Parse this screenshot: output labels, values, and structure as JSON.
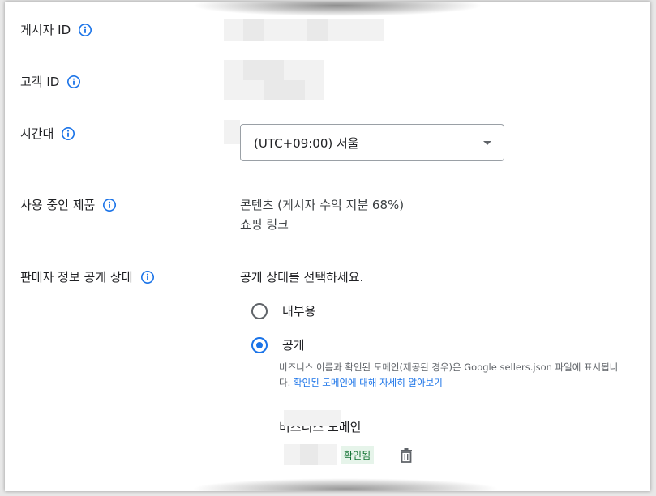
{
  "fields": {
    "publisher_id": {
      "label": "게시자 ID"
    },
    "customer_id": {
      "label": "고객 ID"
    },
    "timezone": {
      "label": "시간대",
      "value": "(UTC+09:00) 서울"
    },
    "products": {
      "label": "사용 중인 제품",
      "items": [
        "콘텐츠 (게시자 수익 지분 68%)",
        "쇼핑 링크"
      ]
    }
  },
  "seller_info": {
    "label": "판매자 정보 공개 상태",
    "prompt": "공개 상태를 선택하세요.",
    "options": [
      {
        "label": "내부용",
        "selected": false
      },
      {
        "label": "공개",
        "selected": true
      }
    ],
    "help_text": "비즈니스 이름과 확인된 도메인(제공된 경우)은 Google sellers.json 파일에 표시됩니다.",
    "help_link": "확인된 도메인에 대해 자세히 알아보기",
    "domain_label": "비즈니스 도메인",
    "verified_badge": "확인됨"
  },
  "colors": {
    "accent": "#1a73e8",
    "badge_bg": "#e6f4ea",
    "badge_text": "#137333"
  },
  "icons": {
    "info": "info-circle-icon",
    "dropdown": "caret-down-icon",
    "delete": "trash-icon"
  }
}
